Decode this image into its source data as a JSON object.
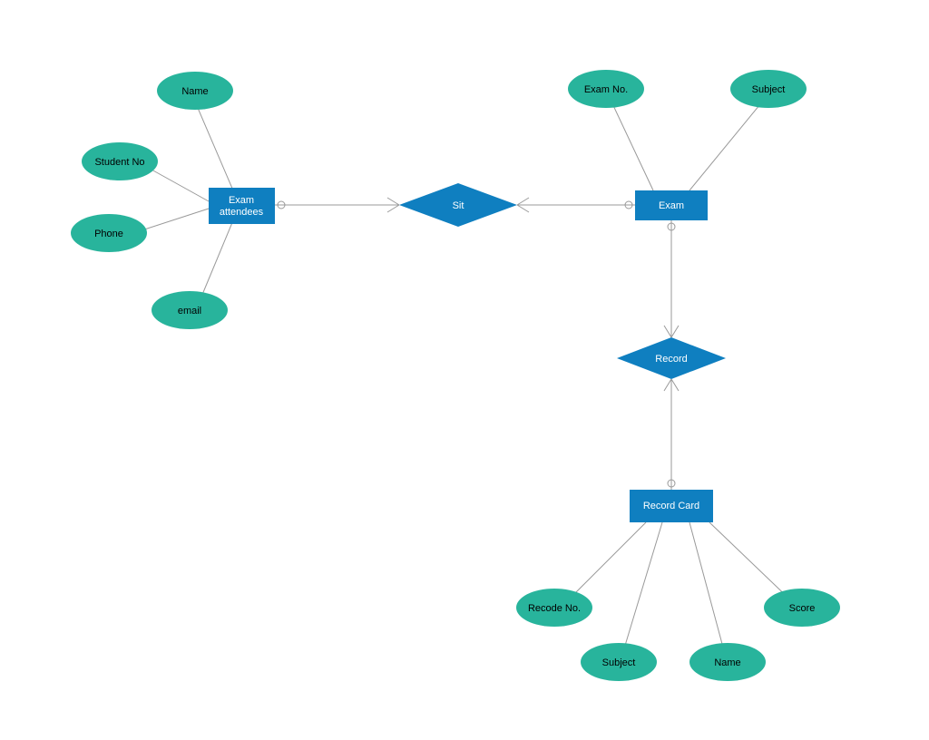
{
  "entities": {
    "exam_attendees": "Exam attendees",
    "exam": "Exam",
    "record_card": "Record Card"
  },
  "relationships": {
    "sit": "Sit",
    "record": "Record"
  },
  "attributes": {
    "name1": "Name",
    "student_no": "Student No",
    "phone": "Phone",
    "email": "email",
    "exam_no": "Exam No.",
    "subject1": "Subject",
    "recode_no": "Recode No.",
    "subject2": "Subject",
    "name2": "Name",
    "score": "Score"
  }
}
